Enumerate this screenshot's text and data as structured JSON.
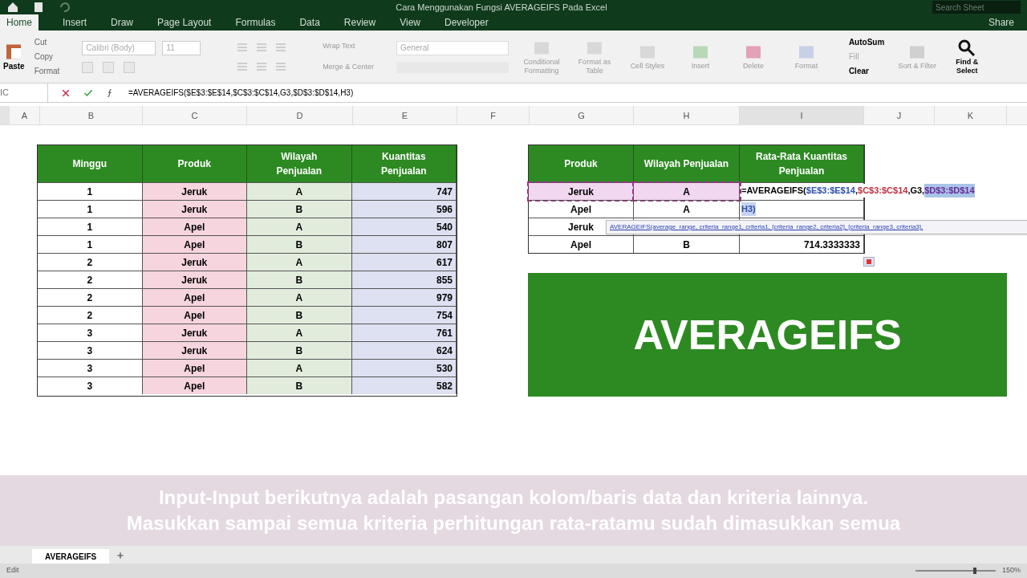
{
  "title_bar": {
    "title": "Cara Menggunakan Fungsi AVERAGEIFS Pada Excel",
    "search_placeholder": "Search Sheet",
    "share": "Share"
  },
  "ribbon_tabs": [
    {
      "label": "Home",
      "selected": true
    },
    {
      "label": "Insert",
      "selected": false
    },
    {
      "label": "Draw",
      "selected": false
    },
    {
      "label": "Page Layout",
      "selected": false
    },
    {
      "label": "Formulas",
      "selected": false
    },
    {
      "label": "Data",
      "selected": false
    },
    {
      "label": "Review",
      "selected": false
    },
    {
      "label": "View",
      "selected": false
    },
    {
      "label": "Developer",
      "selected": false
    }
  ],
  "ribbon": {
    "paste": "Paste",
    "clipboard": [
      "Cut",
      "Copy",
      "Format"
    ],
    "font": "Calibri (Body)",
    "size": "11",
    "wrap": "Wrap Text",
    "merge": "Merge & Center",
    "number_format": "General",
    "styles": [
      "Conditional Formatting",
      "Format as Table",
      "Cell Styles"
    ],
    "cells": [
      "Insert",
      "Delete",
      "Format"
    ],
    "editing": [
      "AutoSum",
      "Fill",
      "Clear"
    ],
    "sort": "Sort & Filter",
    "find": "Find & Select"
  },
  "formula_bar": {
    "name_box": "IC",
    "formula": "=AVERAGEIFS($E$3:$E$14,$C$3:$C$14,G3,$D$3:$D$14,H3)"
  },
  "columns": [
    "A",
    "B",
    "C",
    "D",
    "E",
    "F",
    "G",
    "H",
    "I",
    "J",
    "K"
  ],
  "left_table": {
    "columns": [
      {
        "header": "Minggu",
        "color": "#ffffff"
      },
      {
        "header": "Produk",
        "color": "#f6d5df"
      },
      {
        "header": "Wilayah Penjualan",
        "color": "#e1ecdd"
      },
      {
        "header": "Kuantitas Penjualan",
        "color": "#dde1f1"
      }
    ],
    "rows": [
      [
        "1",
        "Jeruk",
        "A",
        "747"
      ],
      [
        "1",
        "Jeruk",
        "B",
        "596"
      ],
      [
        "1",
        "Apel",
        "A",
        "540"
      ],
      [
        "1",
        "Apel",
        "B",
        "807"
      ],
      [
        "2",
        "Jeruk",
        "A",
        "617"
      ],
      [
        "2",
        "Jeruk",
        "B",
        "855"
      ],
      [
        "2",
        "Apel",
        "A",
        "979"
      ],
      [
        "2",
        "Apel",
        "B",
        "754"
      ],
      [
        "3",
        "Jeruk",
        "A",
        "761"
      ],
      [
        "3",
        "Jeruk",
        "B",
        "624"
      ],
      [
        "3",
        "Apel",
        "A",
        "530"
      ],
      [
        "3",
        "Apel",
        "B",
        "582"
      ]
    ]
  },
  "right_table": {
    "columns": [
      "Produk",
      "Wilayah Penjualan",
      "Rata-Rata Kuantitas Penjualan"
    ],
    "rows": [
      {
        "cells": [
          "Jeruk",
          "A"
        ],
        "referenced": true
      },
      {
        "cells": [
          "Apel",
          "A"
        ],
        "referenced": false
      },
      {
        "cells": [
          "Jeruk"
        ],
        "referenced": false
      },
      {
        "cells": [
          "Apel",
          "B",
          "714.3333333"
        ],
        "referenced": false
      }
    ],
    "editing": {
      "segments": [
        {
          "text": "=AVERAGEIFS(",
          "kind": "plain"
        },
        {
          "text": "$E$3:$E$14",
          "kind": "blue"
        },
        {
          "text": ",",
          "kind": "plain"
        },
        {
          "text": "$C$3:$C$14",
          "kind": "red"
        },
        {
          "text": ",G3,",
          "kind": "plain"
        },
        {
          "text": "$D$3:$D$14",
          "kind": "selected"
        }
      ],
      "second_line": "H3)"
    },
    "tooltip": "AVERAGEIFS(average_range, criteria_range1, criteria1, [criteria_range2, criteria2], [criteria_range3, criteria3],"
  },
  "banner": "AVERAGEIFS",
  "sheet_tabs": [
    {
      "label": "AVERAGEIFS",
      "selected": true
    }
  ],
  "subtitle": [
    "Input-Input berikutnya adalah pasangan kolom/baris data dan kriteria lainnya.",
    "Masukkan sampai semua kriteria perhitungan rata-ratamu sudah dimasukkan semua"
  ],
  "status_bar": {
    "mode": "Edit",
    "zoom": "150%",
    "zoom_slider": {
      "level": 0.75
    }
  }
}
